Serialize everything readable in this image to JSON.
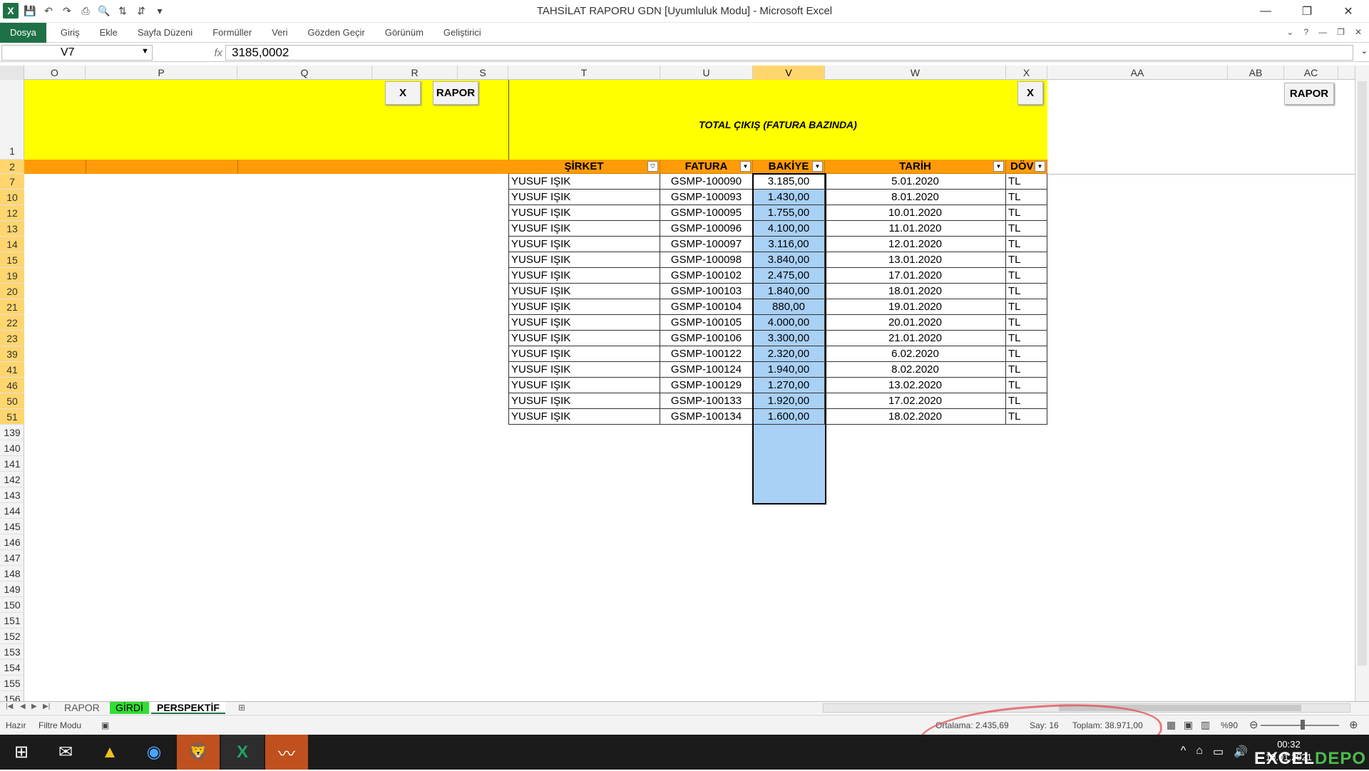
{
  "window": {
    "title": "TAHSİLAT RAPORU GDN  [Uyumluluk Modu]  -  Microsoft Excel",
    "minimize": "—",
    "restore": "❐",
    "close": "✕"
  },
  "ribbon": {
    "tabs": [
      "Dosya",
      "Giriş",
      "Ekle",
      "Sayfa Düzeni",
      "Formüller",
      "Veri",
      "Gözden Geçir",
      "Görünüm",
      "Geliştirici"
    ],
    "controls": [
      "⌄",
      "?",
      "—",
      "❐",
      "✕"
    ]
  },
  "formula": {
    "namebox": "V7",
    "fx": "fx",
    "value": "3185,0002"
  },
  "columns": {
    "left": [
      "O",
      "P",
      "Q",
      "R",
      "S"
    ],
    "table": [
      "T",
      "U",
      "V",
      "W",
      "X"
    ],
    "right": [
      "AA",
      "AB",
      "AC"
    ]
  },
  "rows": [
    "1",
    "2",
    "7",
    "10",
    "12",
    "13",
    "14",
    "15",
    "19",
    "20",
    "21",
    "22",
    "23",
    "39",
    "41",
    "46",
    "50",
    "51",
    "139",
    "140",
    "141",
    "142",
    "143",
    "144",
    "145",
    "146",
    "147",
    "148",
    "149",
    "150",
    "151",
    "152",
    "153",
    "154",
    "155",
    "156"
  ],
  "buttons": {
    "x_left": "X",
    "rapor_left": "RAPOR",
    "x_right": "X",
    "rapor_right": "RAPOR"
  },
  "table_title": "TOTAL ÇIKIŞ (FATURA BAZINDA)",
  "table_headers": [
    "ŞİRKET",
    "FATURA",
    "BAKİYE",
    "TARİH",
    "DÖV"
  ],
  "table_rows": [
    [
      "YUSUF IŞIK",
      "GSMP-100090",
      "3.185,00",
      "5.01.2020",
      "TL"
    ],
    [
      "YUSUF IŞIK",
      "GSMP-100093",
      "1.430,00",
      "8.01.2020",
      "TL"
    ],
    [
      "YUSUF IŞIK",
      "GSMP-100095",
      "1.755,00",
      "10.01.2020",
      "TL"
    ],
    [
      "YUSUF IŞIK",
      "GSMP-100096",
      "4.100,00",
      "11.01.2020",
      "TL"
    ],
    [
      "YUSUF IŞIK",
      "GSMP-100097",
      "3.116,00",
      "12.01.2020",
      "TL"
    ],
    [
      "YUSUF IŞIK",
      "GSMP-100098",
      "3.840,00",
      "13.01.2020",
      "TL"
    ],
    [
      "YUSUF IŞIK",
      "GSMP-100102",
      "2.475,00",
      "17.01.2020",
      "TL"
    ],
    [
      "YUSUF IŞIK",
      "GSMP-100103",
      "1.840,00",
      "18.01.2020",
      "TL"
    ],
    [
      "YUSUF IŞIK",
      "GSMP-100104",
      "880,00",
      "19.01.2020",
      "TL"
    ],
    [
      "YUSUF IŞIK",
      "GSMP-100105",
      "4.000,00",
      "20.01.2020",
      "TL"
    ],
    [
      "YUSUF IŞIK",
      "GSMP-100106",
      "3.300,00",
      "21.01.2020",
      "TL"
    ],
    [
      "YUSUF IŞIK",
      "GSMP-100122",
      "2.320,00",
      "6.02.2020",
      "TL"
    ],
    [
      "YUSUF IŞIK",
      "GSMP-100124",
      "1.940,00",
      "8.02.2020",
      "TL"
    ],
    [
      "YUSUF IŞIK",
      "GSMP-100129",
      "1.270,00",
      "13.02.2020",
      "TL"
    ],
    [
      "YUSUF IŞIK",
      "GSMP-100133",
      "1.920,00",
      "17.02.2020",
      "TL"
    ],
    [
      "YUSUF IŞIK",
      "GSMP-100134",
      "1.600,00",
      "18.02.2020",
      "TL"
    ]
  ],
  "sheets": [
    "RAPOR",
    "GİRDİ",
    "PERSPEKTİF"
  ],
  "status": {
    "ready": "Hazır",
    "mode": "Filtre Modu",
    "average": "Ortalama: 2.435,69",
    "count": "Say: 16",
    "sum": "Toplam: 38.971,00",
    "zoom": "%90"
  },
  "taskbar": {
    "time": "00:32",
    "date": "10.01.2021",
    "brand_a": "EXCEL",
    "brand_b": "DEPO"
  },
  "colors": {
    "yellow": "#ffff00",
    "orange": "#ff9b06",
    "selection_blue": "#a9d0f5",
    "excel_green": "#1e7145"
  }
}
